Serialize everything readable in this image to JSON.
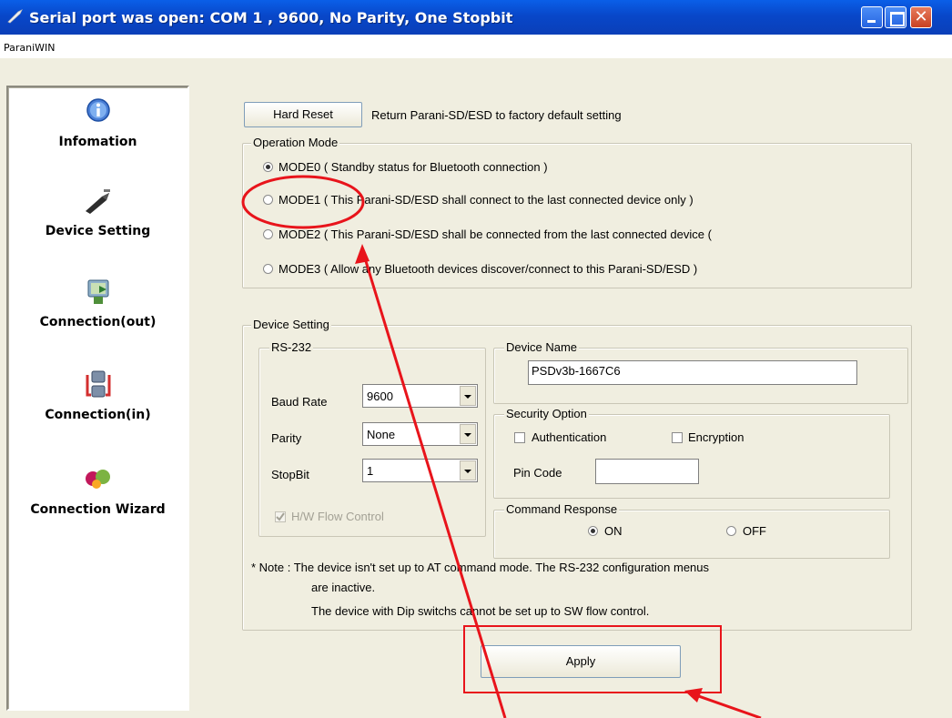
{
  "window": {
    "title": "Serial port was open: COM 1 , 9600, No Parity, One Stopbit",
    "menu_label": "ParaniWIN",
    "close_glyph": "✕"
  },
  "nav": {
    "items": [
      {
        "label": "Infomation",
        "icon": "info-icon"
      },
      {
        "label": "Device Setting",
        "icon": "device-icon"
      },
      {
        "label": "Connection(out)",
        "icon": "connection-out-icon"
      },
      {
        "label": "Connection(in)",
        "icon": "connection-in-icon"
      },
      {
        "label": "Connection Wizard",
        "icon": "wizard-icon"
      }
    ]
  },
  "main": {
    "hard_reset_label": "Hard Reset",
    "hard_reset_desc": "Return Parani-SD/ESD to factory default setting",
    "operation_mode": {
      "title": "Operation Mode",
      "options": [
        {
          "label": "MODE0 ( Standby status for Bluetooth connection )",
          "selected": true
        },
        {
          "label": "MODE1 ( This Parani-SD/ESD shall connect to the last connected device only )",
          "selected": false
        },
        {
          "label": "MODE2 ( This Parani-SD/ESD shall be connected from the last connected device (",
          "selected": false
        },
        {
          "label": "MODE3 ( Allow any Bluetooth devices discover/connect to this Parani-SD/ESD )",
          "selected": false
        }
      ]
    },
    "device_setting": {
      "title": "Device Setting",
      "rs232": {
        "title": "RS-232",
        "baud_label": "Baud Rate",
        "baud_value": "9600",
        "parity_label": "Parity",
        "parity_value": "None",
        "stopbit_label": "StopBit",
        "stopbit_value": "1",
        "hw_flow_label": "H/W Flow Control",
        "hw_flow_checked": true
      },
      "device_name": {
        "title": "Device Name",
        "value": "PSDv3b-1667C6"
      },
      "security": {
        "title": "Security Option",
        "auth_label": "Authentication",
        "enc_label": "Encryption",
        "pin_label": "Pin Code",
        "pin_value": ""
      },
      "command_response": {
        "title": "Command Response",
        "on_label": "ON",
        "off_label": "OFF",
        "selected": "ON"
      },
      "note_line1": "* Note : The device isn't set up to AT command mode. The RS-232 configuration menus",
      "note_line2": "are inactive.",
      "note_line3": "The device with Dip switchs cannot be set up to SW flow control."
    },
    "apply_label": "Apply"
  },
  "colors": {
    "annotation_red": "#e8141b",
    "titlebar_blue": "#0a5fe8"
  }
}
